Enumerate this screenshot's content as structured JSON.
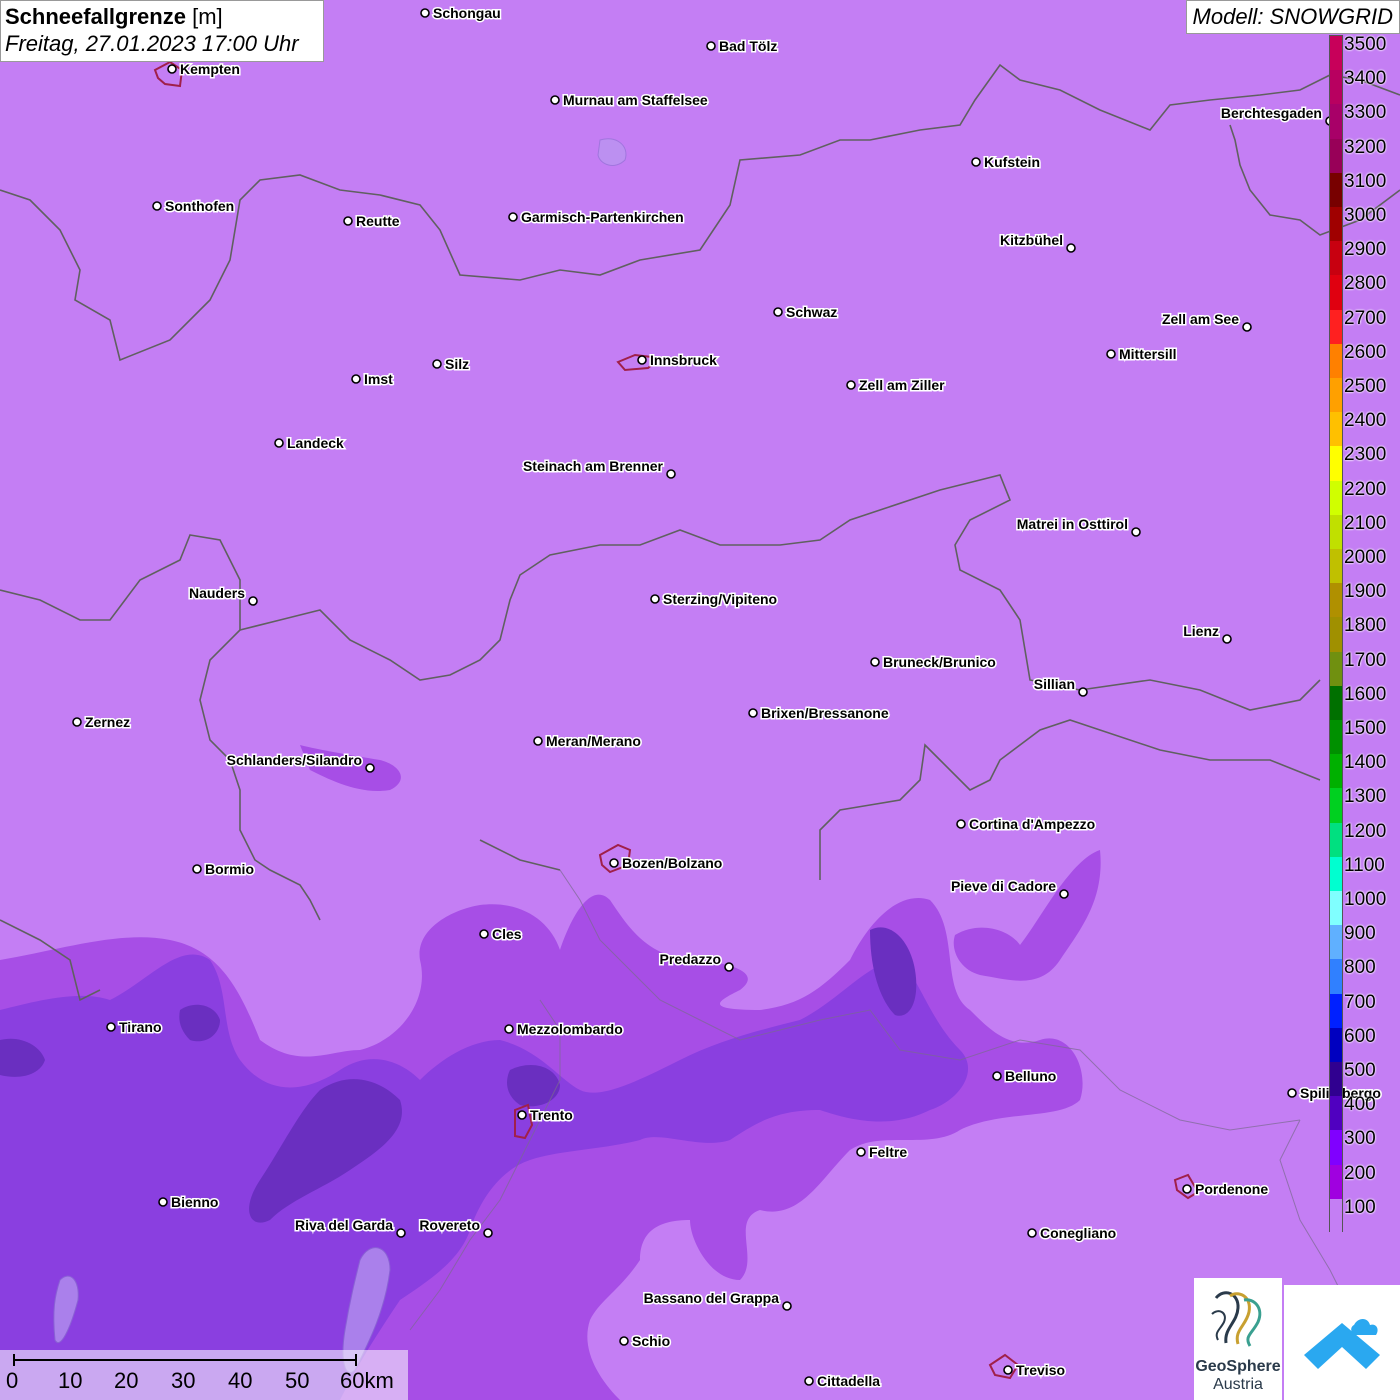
{
  "title": {
    "param": "Schneefallgrenze",
    "unit": "[m]",
    "datetime": "Freitag, 27.01.2023 17:00 Uhr"
  },
  "model": "Modell: SNOWGRID",
  "legend": {
    "labels": [
      "3500",
      "3400",
      "3300",
      "3200",
      "3100",
      "3000",
      "2900",
      "2800",
      "2700",
      "2600",
      "2500",
      "2400",
      "2300",
      "2200",
      "2100",
      "2000",
      "1900",
      "1800",
      "1700",
      "1600",
      "1500",
      "1400",
      "1300",
      "1200",
      "1100",
      "1000",
      "900",
      "800",
      "700",
      "600",
      "500",
      "400",
      "300",
      "200",
      "100"
    ],
    "colors": [
      "#c8005a",
      "#b80060",
      "#a80068",
      "#980058",
      "#780000",
      "#a00000",
      "#c80010",
      "#e00010",
      "#ff2020",
      "#ff8000",
      "#ffa000",
      "#ffc000",
      "#ffff00",
      "#d0ff00",
      "#c0e000",
      "#c0c000",
      "#b09000",
      "#a09000",
      "#709010",
      "#007000",
      "#009000",
      "#00b000",
      "#00d020",
      "#00e080",
      "#00ffd0",
      "#80ffff",
      "#60b0ff",
      "#3080ff",
      "#0020ff",
      "#0000c0",
      "#300090",
      "#5000c0",
      "#8000ff",
      "#a000e0",
      "#c47ef4"
    ]
  },
  "cities": [
    {
      "name": "Schongau",
      "label_side": "right"
    },
    {
      "name": "Bad Tölz",
      "label_side": "right"
    },
    {
      "name": "Kempten",
      "label_side": "right"
    },
    {
      "name": "Murnau am Staffelsee",
      "label_side": "right"
    },
    {
      "name": "Berchtesgaden",
      "label_side": "left"
    },
    {
      "name": "Kufstein",
      "label_side": "right"
    },
    {
      "name": "Sonthofen",
      "label_side": "right"
    },
    {
      "name": "Reutte",
      "label_side": "right"
    },
    {
      "name": "Garmisch-Partenkirchen",
      "label_side": "right"
    },
    {
      "name": "Kitzbühel",
      "label_side": "left"
    },
    {
      "name": "Schwaz",
      "label_side": "right"
    },
    {
      "name": "Zell am See",
      "label_side": "left"
    },
    {
      "name": "Innsbruck",
      "label_side": "right"
    },
    {
      "name": "Mittersill",
      "label_side": "right"
    },
    {
      "name": "Imst",
      "label_side": "right"
    },
    {
      "name": "Silz",
      "label_side": "right"
    },
    {
      "name": "Zell am Ziller",
      "label_side": "right"
    },
    {
      "name": "Landeck",
      "label_side": "right"
    },
    {
      "name": "Steinach am Brenner",
      "label_side": "left"
    },
    {
      "name": "Matrei in Osttirol",
      "label_side": "left"
    },
    {
      "name": "Nauders",
      "label_side": "left"
    },
    {
      "name": "Sterzing/Vipiteno",
      "label_side": "right"
    },
    {
      "name": "Lienz",
      "label_side": "left"
    },
    {
      "name": "Bruneck/Brunico",
      "label_side": "right"
    },
    {
      "name": "Sillian",
      "label_side": "left"
    },
    {
      "name": "Zernez",
      "label_side": "right"
    },
    {
      "name": "Brixen/Bressanone",
      "label_side": "right"
    },
    {
      "name": "Meran/Merano",
      "label_side": "right"
    },
    {
      "name": "Schlanders/Silandro",
      "label_side": "left"
    },
    {
      "name": "Cortina d'Ampezzo",
      "label_side": "right"
    },
    {
      "name": "Bozen/Bolzano",
      "label_side": "right"
    },
    {
      "name": "Bormio",
      "label_side": "right"
    },
    {
      "name": "Pieve di Cadore",
      "label_side": "left"
    },
    {
      "name": "Cles",
      "label_side": "right"
    },
    {
      "name": "Predazzo",
      "label_side": "left"
    },
    {
      "name": "Tirano",
      "label_side": "right"
    },
    {
      "name": "Mezzolombardo",
      "label_side": "right"
    },
    {
      "name": "Belluno",
      "label_side": "right"
    },
    {
      "name": "Spilimbergo",
      "label_side": "right"
    },
    {
      "name": "Trento",
      "label_side": "right"
    },
    {
      "name": "Feltre",
      "label_side": "right"
    },
    {
      "name": "Pordenone",
      "label_side": "right"
    },
    {
      "name": "Bienno",
      "label_side": "right"
    },
    {
      "name": "Riva del Garda",
      "label_side": "left"
    },
    {
      "name": "Rovereto",
      "label_side": "left"
    },
    {
      "name": "Conegliano",
      "label_side": "right"
    },
    {
      "name": "Bassano del Grappa",
      "label_side": "left"
    },
    {
      "name": "Schio",
      "label_side": "right"
    },
    {
      "name": "Treviso",
      "label_side": "right"
    },
    {
      "name": "Cittadella",
      "label_side": "right"
    }
  ],
  "scalebar": {
    "ticks": [
      "0",
      "10",
      "20",
      "30",
      "40",
      "50",
      "60km"
    ]
  },
  "logo": {
    "line1": "GeoSphere",
    "line2": "Austria"
  },
  "colors": {
    "base": "#c47ef4",
    "low_snowline": "#a74ee6",
    "mid_snowline": "#8a3fe0",
    "deep": "#6a2fc0",
    "border": "#606060"
  }
}
